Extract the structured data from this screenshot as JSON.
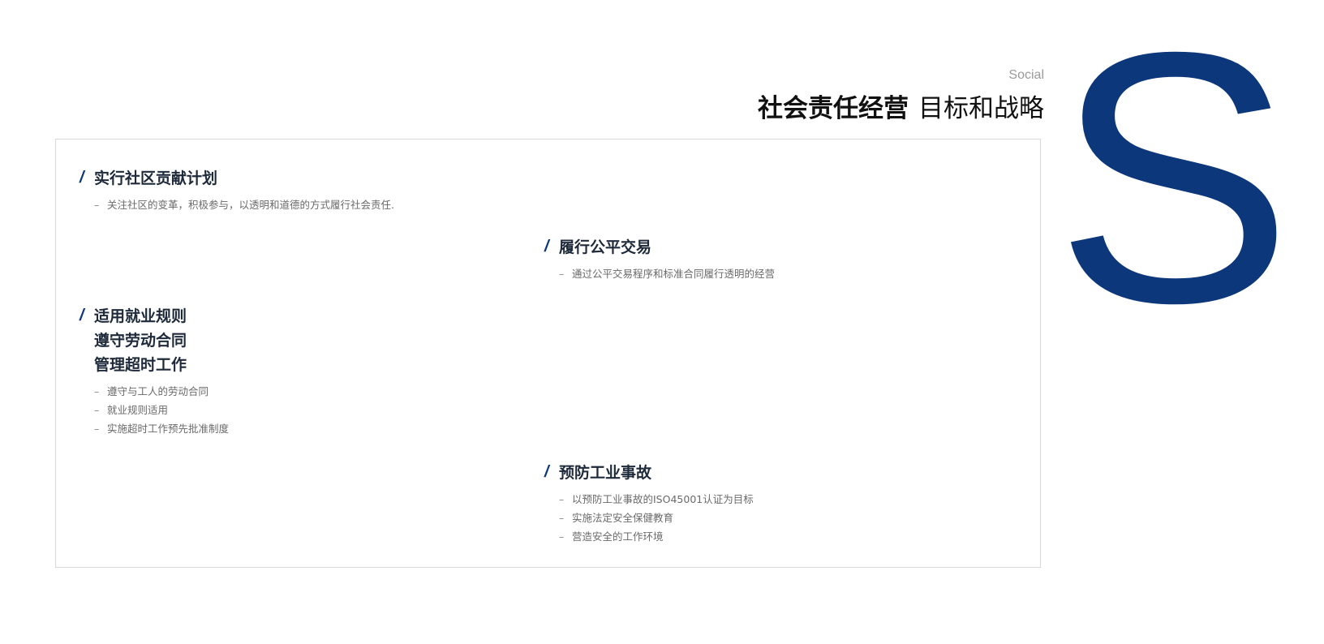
{
  "header": {
    "subtitle": "Social",
    "title_bold": "社会责任经营",
    "title_light": "目标和战略"
  },
  "decor": {
    "big_letter": "S",
    "accent_color": "#0c377a"
  },
  "blocks": [
    {
      "title_lines": [
        "实行社区贡献计划"
      ],
      "bullets": [
        "关注社区的变革，积极参与，以透明和道德的方式履行社会责任."
      ]
    },
    {
      "title_lines": [
        "履行公平交易"
      ],
      "bullets": [
        "通过公平交易程序和标准合同履行透明的经营"
      ]
    },
    {
      "title_lines": [
        "适用就业规则",
        "遵守劳动合同",
        "管理超时工作"
      ],
      "bullets": [
        "遵守与工人的劳动合同",
        "就业规则适用",
        "实施超时工作预先批准制度"
      ]
    },
    {
      "title_lines": [
        "预防工业事故"
      ],
      "bullets": [
        "以预防工业事故的ISO45001认证为目标",
        "实施法定安全保健教育",
        "营造安全的工作环境"
      ]
    }
  ]
}
